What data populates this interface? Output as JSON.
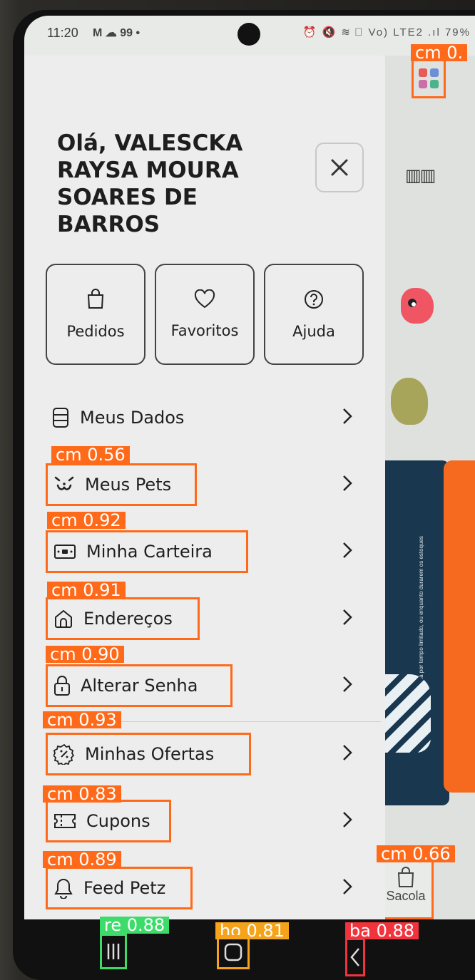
{
  "status_bar": {
    "time": "11:20",
    "left_icons": "M ☁ 99 •",
    "battery": "79%",
    "right_icons": "⏰ 🔇 ≋ ⃠ Vo) LTE2 .ıl"
  },
  "drawer": {
    "greeting": "Olá, VALESCKA RAYSA MOURA SOARES DE BARROS",
    "close_icon": "close-icon",
    "tiles": [
      {
        "label": "Pedidos",
        "icon": "bag-icon"
      },
      {
        "label": "Favoritos",
        "icon": "heart-icon"
      },
      {
        "label": "Ajuda",
        "icon": "help-icon"
      }
    ],
    "menu": [
      {
        "label": "Meus Dados",
        "icon": "database-icon"
      },
      {
        "label": "Meus Pets",
        "icon": "pet-face-icon"
      },
      {
        "label": "Minha Carteira",
        "icon": "wallet-icon"
      },
      {
        "label": "Endereços",
        "icon": "home-icon"
      },
      {
        "label": "Alterar Senha",
        "icon": "lock-icon"
      },
      {
        "label": "Minhas Ofertas",
        "icon": "discount-icon"
      },
      {
        "label": "Cupons",
        "icon": "ticket-icon"
      },
      {
        "label": "Feed Petz",
        "icon": "bell-icon"
      }
    ]
  },
  "background_app": {
    "sacola_label": "Sacola",
    "promo_text": "Promoção válida por tempo limitado, ou enquanto durarem os estoques"
  },
  "detections": {
    "apps": "cm 0.",
    "meus_pets": "cm 0.56",
    "minha_carteira": "cm 0.92",
    "enderecos": "cm 0.91",
    "alterar_senha": "cm 0.90",
    "minhas_ofertas": "cm 0.93",
    "cupons": "cm 0.83",
    "feed_petz": "cm 0.89",
    "sacola": "cm 0.66",
    "recents": "re 0.88",
    "home": "ho 0.81",
    "back": "ba 0.88"
  },
  "colors": {
    "detection_orange": "#ff6a1a",
    "detection_green": "#3ddc6a",
    "detection_yellow": "#f5a31a",
    "detection_red": "#f0333c",
    "drawer_bg": "#ededed",
    "promo_blue": "#19384f"
  }
}
